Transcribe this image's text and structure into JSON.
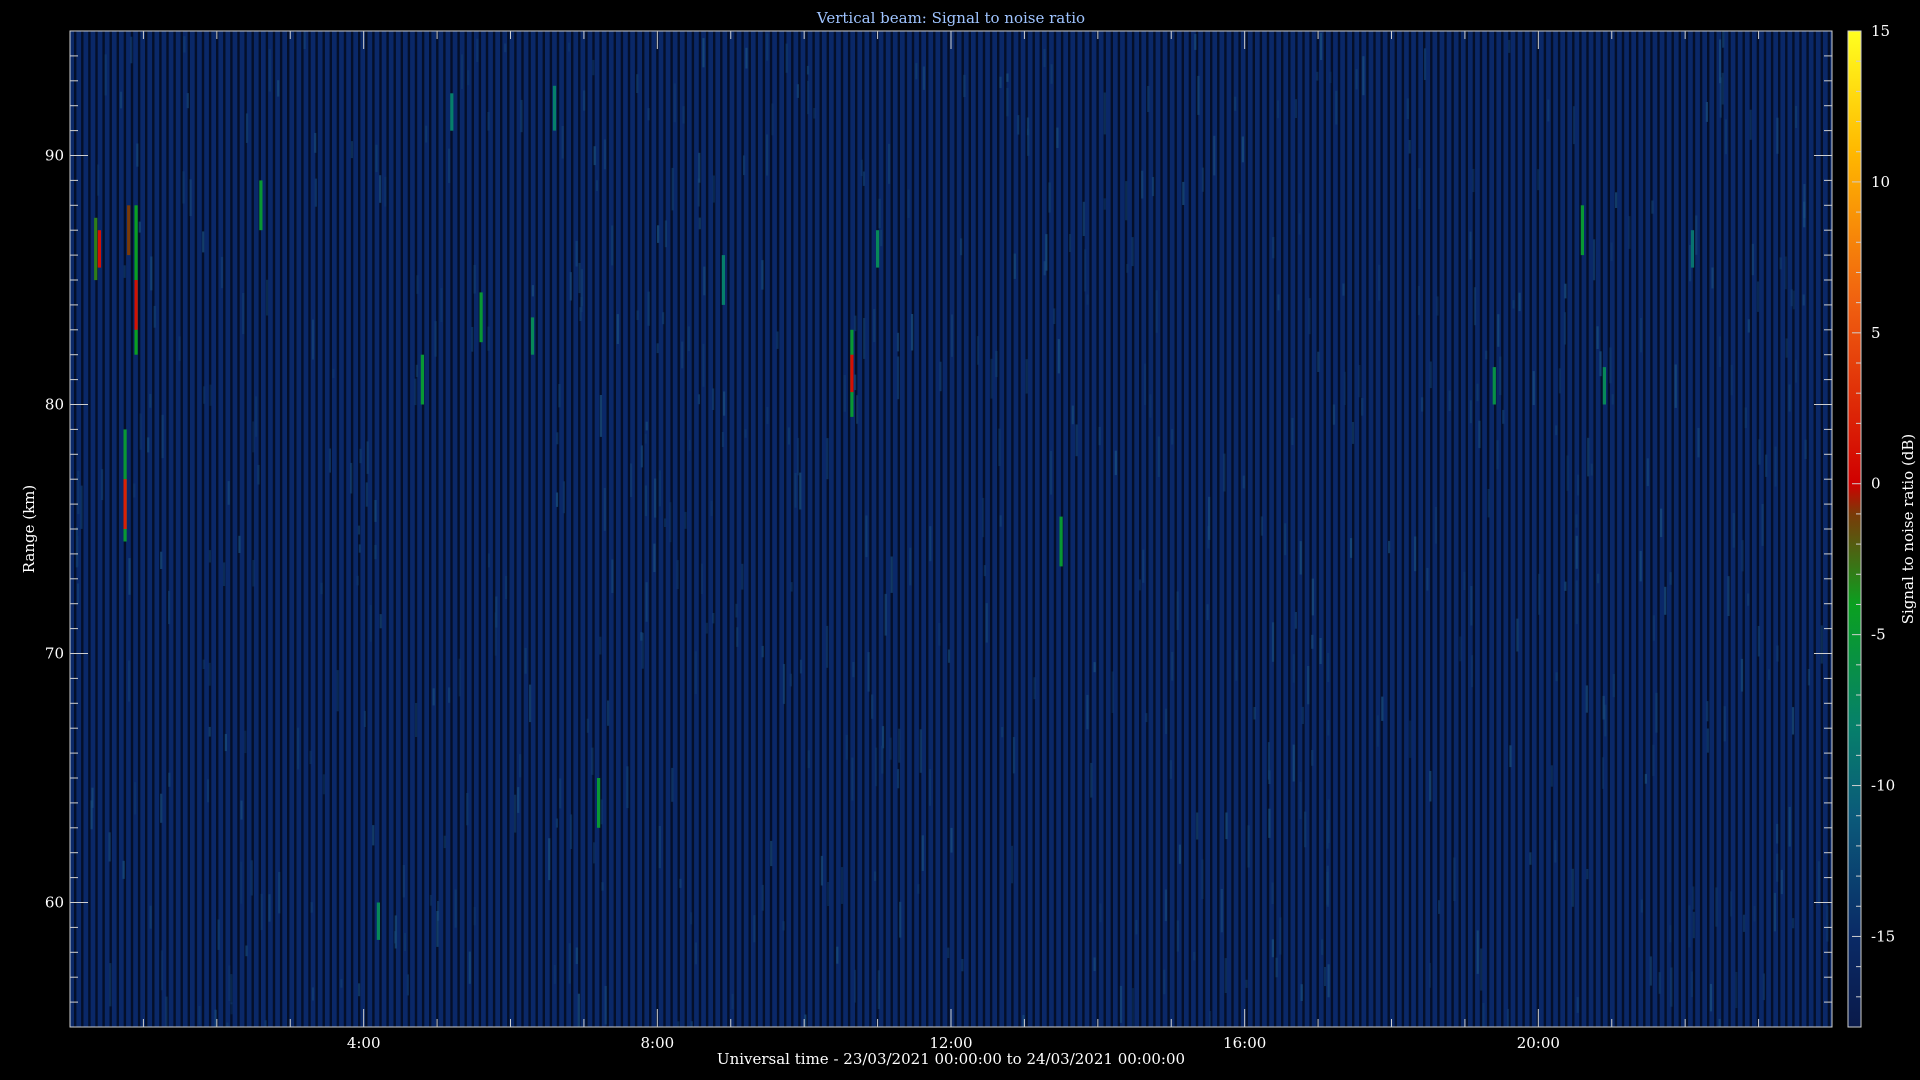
{
  "chart_data": {
    "type": "heatmap",
    "title": "Vertical beam: Signal to noise ratio",
    "xlabel": "Universal time - 23/03/2021 00:00:00 to 24/03/2021 00:00:00",
    "ylabel": "Range (km)",
    "colorbar_label": "Signal to noise ratio (dB)",
    "x_unit": "hours UT",
    "xlim": [
      0,
      24
    ],
    "ylim": [
      55,
      95
    ],
    "x_ticks": [
      {
        "value": 4,
        "label": "4:00"
      },
      {
        "value": 8,
        "label": "8:00"
      },
      {
        "value": 12,
        "label": "12:00"
      },
      {
        "value": 16,
        "label": "16:00"
      },
      {
        "value": 20,
        "label": "20:00"
      }
    ],
    "y_ticks": [
      {
        "value": 60,
        "label": "60"
      },
      {
        "value": 70,
        "label": "70"
      },
      {
        "value": 80,
        "label": "80"
      },
      {
        "value": 90,
        "label": "90"
      }
    ],
    "colorbar_range": [
      -18,
      15
    ],
    "colorbar_ticks": [
      {
        "value": -15,
        "label": "-15"
      },
      {
        "value": -10,
        "label": "-10"
      },
      {
        "value": -5,
        "label": "-5"
      },
      {
        "value": 0,
        "label": "0"
      },
      {
        "value": 5,
        "label": "5"
      },
      {
        "value": 10,
        "label": "10"
      },
      {
        "value": 15,
        "label": "15"
      }
    ],
    "colormap": [
      {
        "v": -18,
        "color": "#0a1a4a"
      },
      {
        "v": -15,
        "color": "#0a2a66"
      },
      {
        "v": -11,
        "color": "#0b5a7a"
      },
      {
        "v": -8,
        "color": "#06806a"
      },
      {
        "v": -4,
        "color": "#0aa020"
      },
      {
        "v": -1,
        "color": "#7a3a08"
      },
      {
        "v": 0,
        "color": "#d00000"
      },
      {
        "v": 6,
        "color": "#f06010"
      },
      {
        "v": 11,
        "color": "#ffb800"
      },
      {
        "v": 15,
        "color": "#ffff20"
      }
    ],
    "background_color": "#0a2868",
    "background_snr_db": -15,
    "events": [
      {
        "time": 0.35,
        "range": [
          85,
          87.5
        ],
        "snr": -3
      },
      {
        "time": 0.4,
        "range": [
          85.5,
          87
        ],
        "snr": 1
      },
      {
        "time": 0.75,
        "range": [
          74.5,
          79
        ],
        "snr": -5
      },
      {
        "time": 0.75,
        "range": [
          75,
          77
        ],
        "snr": 2
      },
      {
        "time": 0.8,
        "range": [
          86,
          88
        ],
        "snr": -1
      },
      {
        "time": 0.9,
        "range": [
          82,
          88
        ],
        "snr": -4
      },
      {
        "time": 0.9,
        "range": [
          83,
          85
        ],
        "snr": 1
      },
      {
        "time": 2.6,
        "range": [
          87,
          89
        ],
        "snr": -5
      },
      {
        "time": 4.2,
        "range": [
          58.5,
          60
        ],
        "snr": -7
      },
      {
        "time": 4.8,
        "range": [
          80,
          82
        ],
        "snr": -5
      },
      {
        "time": 5.2,
        "range": [
          91,
          92.5
        ],
        "snr": -8
      },
      {
        "time": 5.6,
        "range": [
          82.5,
          84.5
        ],
        "snr": -5
      },
      {
        "time": 6.3,
        "range": [
          82,
          83.5
        ],
        "snr": -7
      },
      {
        "time": 6.6,
        "range": [
          91,
          92.8
        ],
        "snr": -8
      },
      {
        "time": 7.2,
        "range": [
          63,
          65
        ],
        "snr": -5
      },
      {
        "time": 8.9,
        "range": [
          84,
          86
        ],
        "snr": -8
      },
      {
        "time": 10.65,
        "range": [
          79.5,
          83
        ],
        "snr": -5
      },
      {
        "time": 10.65,
        "range": [
          80.5,
          82
        ],
        "snr": 1
      },
      {
        "time": 11.0,
        "range": [
          85.5,
          87
        ],
        "snr": -7
      },
      {
        "time": 13.5,
        "range": [
          73.5,
          75.5
        ],
        "snr": -5
      },
      {
        "time": 19.4,
        "range": [
          80,
          81.5
        ],
        "snr": -6
      },
      {
        "time": 20.6,
        "range": [
          86,
          88
        ],
        "snr": -5
      },
      {
        "time": 20.9,
        "range": [
          80,
          81.5
        ],
        "snr": -7
      },
      {
        "time": 22.1,
        "range": [
          85.5,
          87
        ],
        "snr": -9
      }
    ]
  }
}
